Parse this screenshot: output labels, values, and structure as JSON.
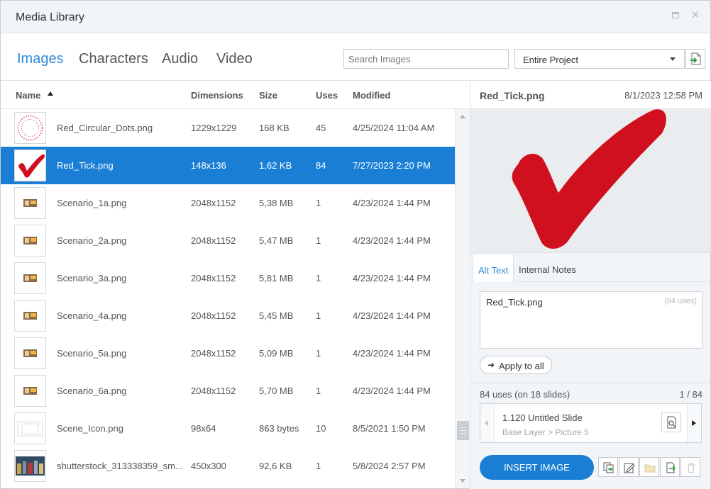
{
  "window": {
    "title": "Media Library"
  },
  "tabs": [
    {
      "label": "Images",
      "active": true
    },
    {
      "label": "Characters",
      "active": false
    },
    {
      "label": "Audio",
      "active": false
    },
    {
      "label": "Video",
      "active": false
    }
  ],
  "search": {
    "placeholder": "Search Images"
  },
  "scope": {
    "value": "Entire Project"
  },
  "columns": {
    "name": "Name",
    "dimensions": "Dimensions",
    "size": "Size",
    "uses": "Uses",
    "modified": "Modified"
  },
  "rows": [
    {
      "name": "Red_Circular_Dots.png",
      "dimensions": "1229x1229",
      "size": "168 KB",
      "uses": "45",
      "modified": "4/25/2024 11:04 AM",
      "thumb": "dots"
    },
    {
      "name": "Red_Tick.png",
      "dimensions": "148x136",
      "size": "1,62 KB",
      "uses": "84",
      "modified": "7/27/2023 2:20 PM",
      "thumb": "tick",
      "selected": true
    },
    {
      "name": "Scenario_1a.png",
      "dimensions": "2048x1152",
      "size": "5,38 MB",
      "uses": "1",
      "modified": "4/23/2024 1:44 PM",
      "thumb": "scene"
    },
    {
      "name": "Scenario_2a.png",
      "dimensions": "2048x1152",
      "size": "5,47 MB",
      "uses": "1",
      "modified": "4/23/2024 1:44 PM",
      "thumb": "scene"
    },
    {
      "name": "Scenario_3a.png",
      "dimensions": "2048x1152",
      "size": "5,81 MB",
      "uses": "1",
      "modified": "4/23/2024 1:44 PM",
      "thumb": "scene"
    },
    {
      "name": "Scenario_4a.png",
      "dimensions": "2048x1152",
      "size": "5,45 MB",
      "uses": "1",
      "modified": "4/23/2024 1:44 PM",
      "thumb": "scene"
    },
    {
      "name": "Scenario_5a.png",
      "dimensions": "2048x1152",
      "size": "5,09 MB",
      "uses": "1",
      "modified": "4/23/2024 1:44 PM",
      "thumb": "scene"
    },
    {
      "name": "Scenario_6a.png",
      "dimensions": "2048x1152",
      "size": "5,70 MB",
      "uses": "1",
      "modified": "4/23/2024 1:44 PM",
      "thumb": "scene"
    },
    {
      "name": "Scene_Icon.png",
      "dimensions": "98x64",
      "size": "863 bytes",
      "uses": "10",
      "modified": "8/5/2021 1:50 PM",
      "thumb": "film"
    },
    {
      "name": "shutterstock_313338359_sm...",
      "dimensions": "450x300",
      "size": "92,6 KB",
      "uses": "1",
      "modified": "5/8/2024 2:57 PM",
      "thumb": "photo"
    }
  ],
  "details": {
    "name": "Red_Tick.png",
    "date": "8/1/2023 12:58 PM",
    "tabs": {
      "alt_text": "Alt Text",
      "internal_notes": "Internal Notes"
    },
    "alt_text": "Red_Tick.png",
    "alt_uses": "(84 uses)",
    "apply_label": "Apply to all",
    "uses_summary": "84 uses (on 18 slides)",
    "uses_position": "1 / 84",
    "slide_title": "1.120 Untitled Slide",
    "slide_layer": "Base Layer > Picture 5",
    "insert_label": "INSERT IMAGE"
  },
  "colors": {
    "accent": "#1a7fd4",
    "tab_active": "#2f8ad8",
    "tick_red": "#d0101e"
  }
}
